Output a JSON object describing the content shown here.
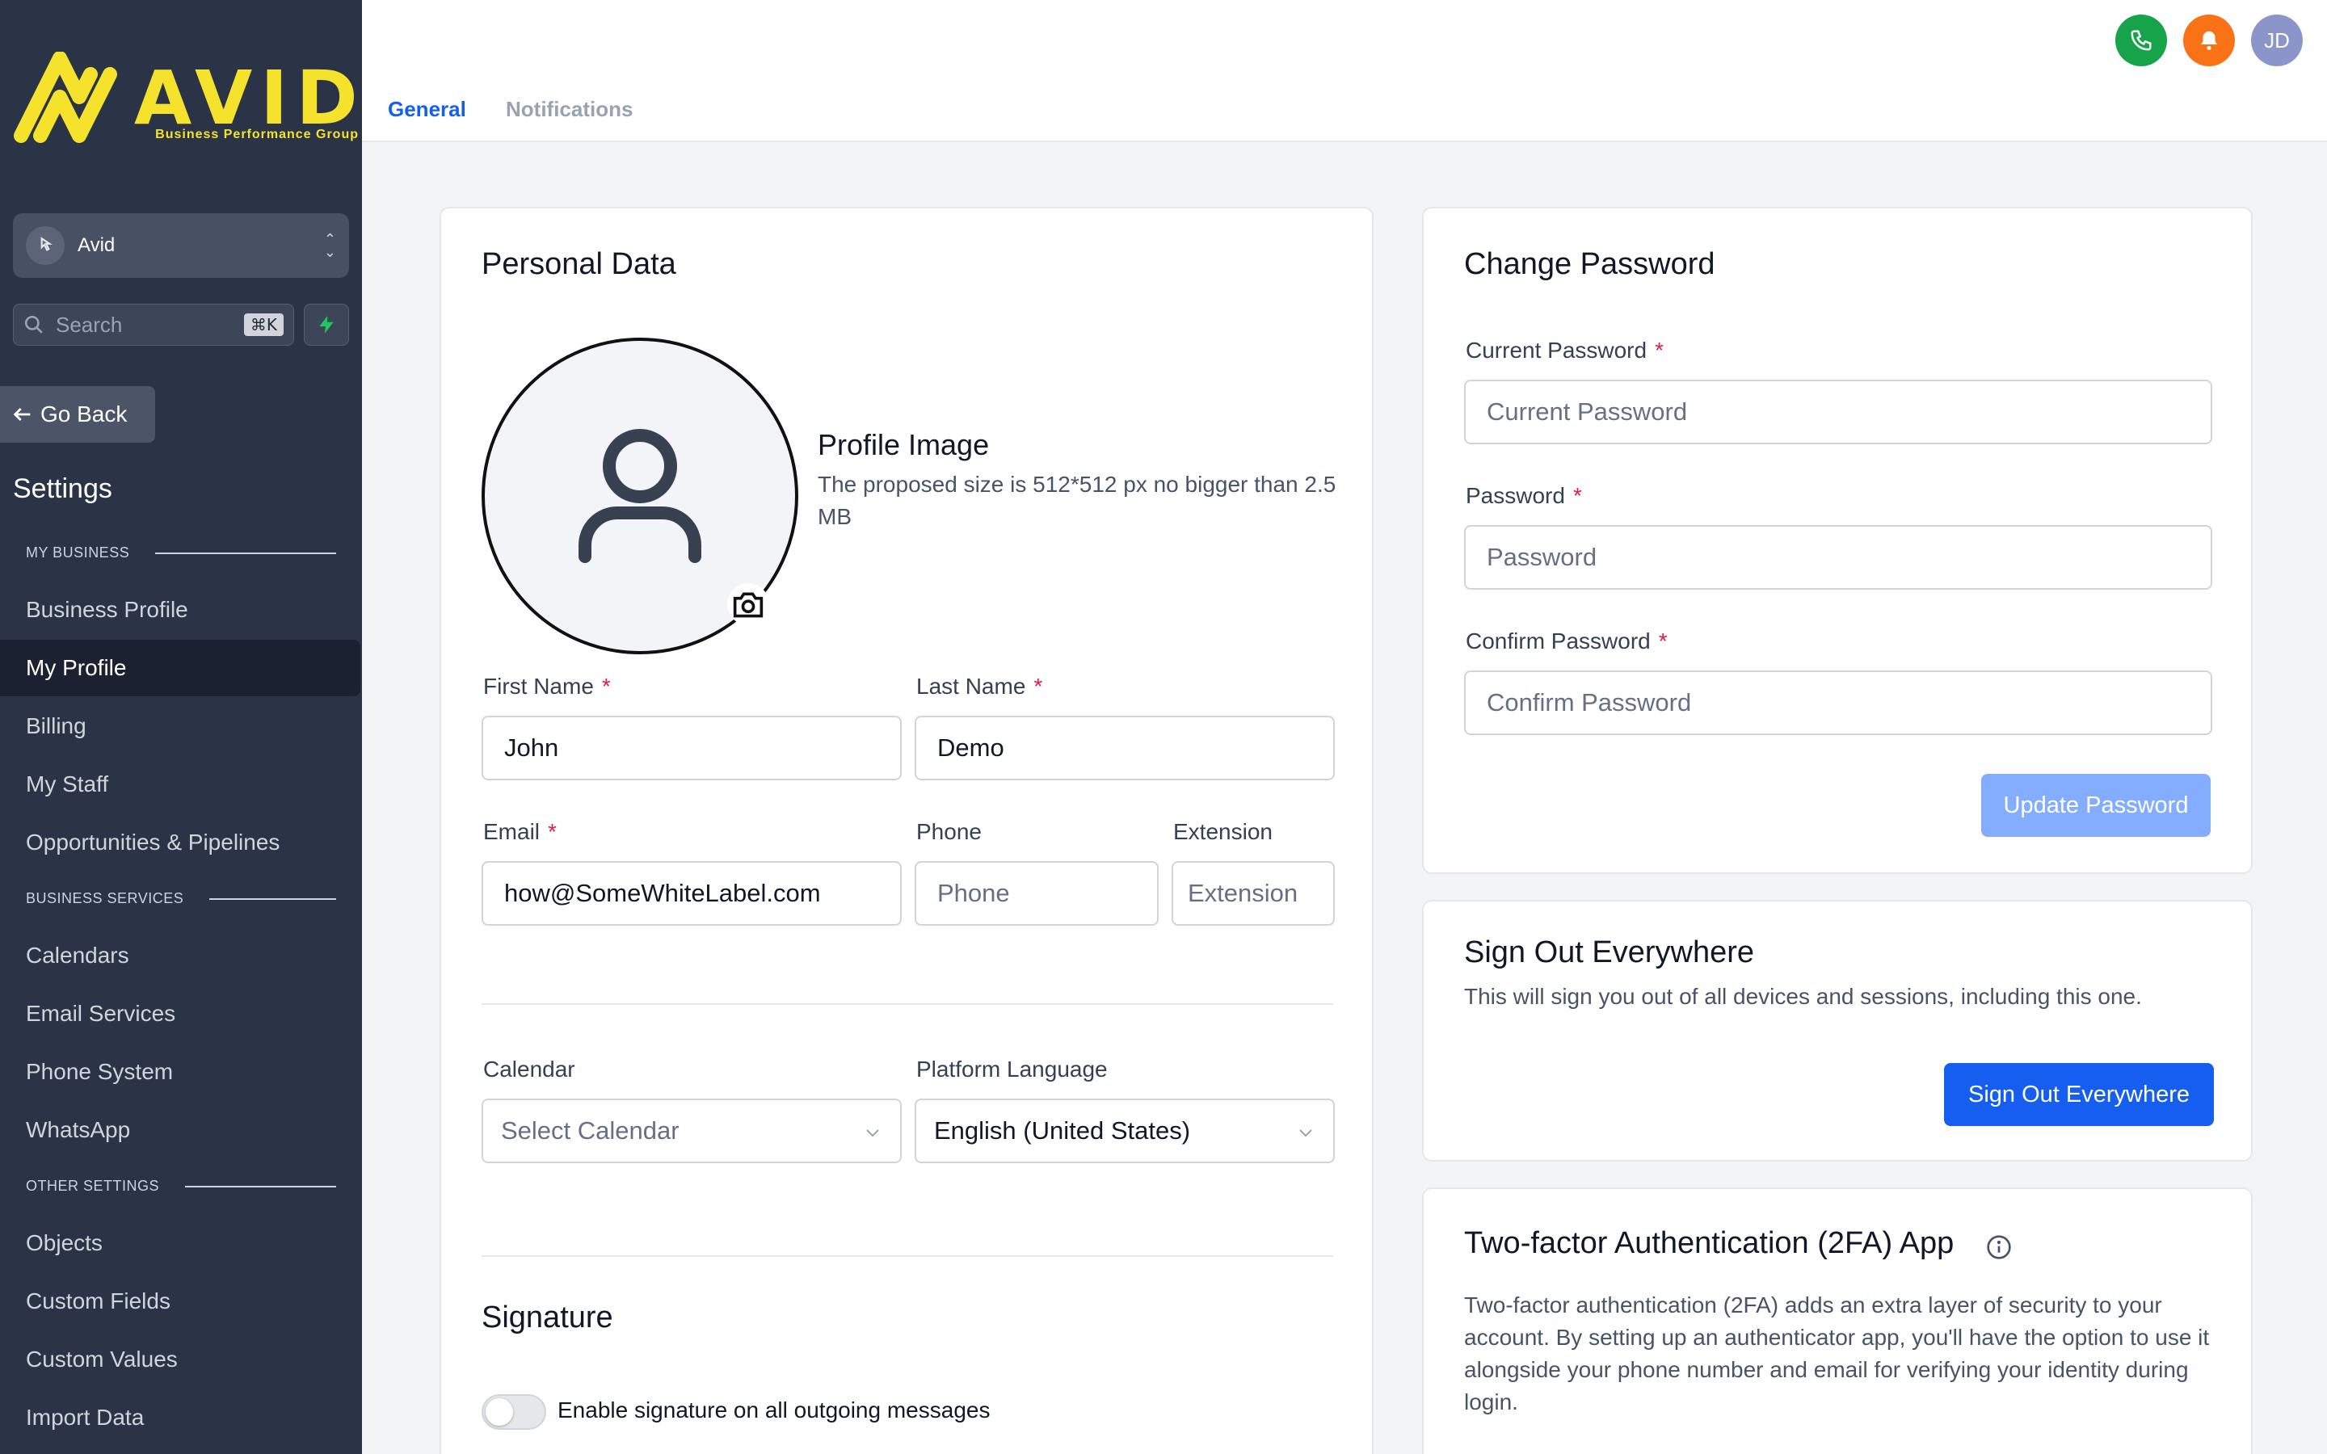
{
  "brand": {
    "logo_word": "AVID",
    "logo_sub": "Business Performance Group",
    "accent": "#f5e22c",
    "sidebar_bg": "#2b3446",
    "primary": "#155eef"
  },
  "sidebar": {
    "account_name": "Avid",
    "search_placeholder": "Search",
    "search_shortcut": "⌘K",
    "go_back": "Go Back",
    "settings_title": "Settings",
    "sections": [
      {
        "title": "MY BUSINESS",
        "items": [
          "Business Profile",
          "My Profile",
          "Billing",
          "My Staff",
          "Opportunities & Pipelines"
        ]
      },
      {
        "title": "BUSINESS SERVICES",
        "items": [
          "Calendars",
          "Email Services",
          "Phone System",
          "WhatsApp"
        ]
      },
      {
        "title": "OTHER SETTINGS",
        "items": [
          "Objects",
          "Custom Fields",
          "Custom Values",
          "Import Data"
        ]
      }
    ],
    "active_item": "My Profile"
  },
  "topbar": {
    "tabs": [
      "General",
      "Notifications"
    ],
    "active_tab": "General",
    "avatar_initials": "JD",
    "icons": [
      "phone-icon",
      "bell-icon"
    ]
  },
  "personal": {
    "title": "Personal Data",
    "profile_image_title": "Profile Image",
    "profile_image_desc": "The proposed size is 512*512 px no bigger than 2.5 MB",
    "first_name_label": "First Name",
    "first_name_value": "John",
    "last_name_label": "Last Name",
    "last_name_value": "Demo",
    "email_label": "Email",
    "email_value": "how@SomeWhiteLabel.com",
    "phone_label": "Phone",
    "phone_placeholder": "Phone",
    "extension_label": "Extension",
    "extension_placeholder": "Extension",
    "calendar_label": "Calendar",
    "calendar_placeholder": "Select Calendar",
    "language_label": "Platform Language",
    "language_value": "English (United States)",
    "signature_title": "Signature",
    "signature_toggle_label": "Enable signature on all outgoing messages",
    "signature_enabled": false,
    "required_mark": "*"
  },
  "password": {
    "title": "Change Password",
    "current_label": "Current Password",
    "current_placeholder": "Current Password",
    "new_label": "Password",
    "new_placeholder": "Password",
    "confirm_label": "Confirm Password",
    "confirm_placeholder": "Confirm Password",
    "button": "Update Password"
  },
  "signout": {
    "title": "Sign Out Everywhere",
    "desc": "This will sign you out of all devices and sessions, including this one.",
    "button": "Sign Out Everywhere"
  },
  "twofa": {
    "title": "Two-factor Authentication (2FA) App",
    "desc": "Two-factor authentication (2FA) adds an extra layer of security to your account. By setting up an authenticator app, you'll have the option to use it alongside your phone number and email for verifying your identity during login."
  }
}
